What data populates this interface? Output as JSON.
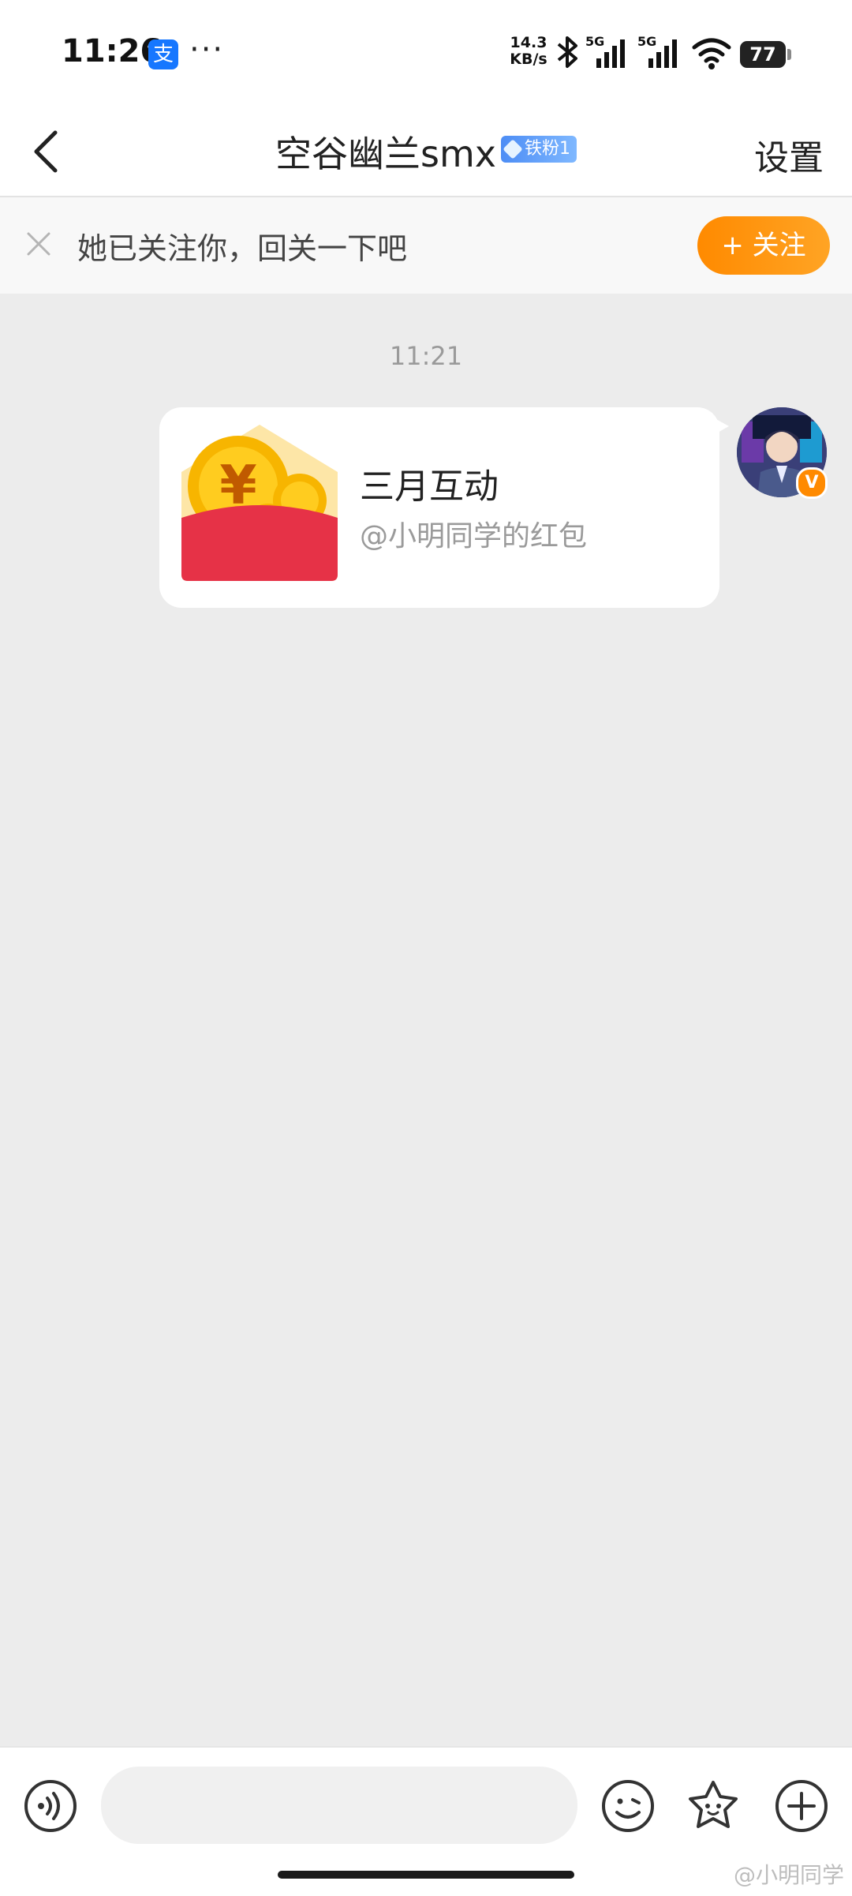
{
  "status_bar": {
    "time": "11:26",
    "alipay_glyph": "支",
    "more": "···",
    "speed_value": "14.3",
    "speed_unit": "KB/s",
    "network_1": "5G",
    "network_2": "5G",
    "battery": "77"
  },
  "header": {
    "title": "空谷幽兰smx",
    "fan_badge": "铁粉1",
    "settings_label": "设置"
  },
  "follow_bar": {
    "message": "她已关注你，回关一下吧",
    "button_label": "+ 关注"
  },
  "chat": {
    "timestamp": "11:21",
    "messages": [
      {
        "type": "red_packet",
        "title": "三月互动",
        "subtitle": "@小明同学的红包",
        "sender": "self"
      }
    ],
    "avatar_badge": "V"
  },
  "composer": {
    "input_placeholder": "",
    "icons": [
      "voice-icon",
      "emoji-icon",
      "sticker-icon",
      "plus-icon"
    ]
  },
  "watermark": "@小明同学",
  "colors": {
    "accent_orange": "#ff8a00",
    "fan_badge_blue": "#4d8df5",
    "red_packet": "#e63247",
    "chat_background": "#ececec"
  }
}
